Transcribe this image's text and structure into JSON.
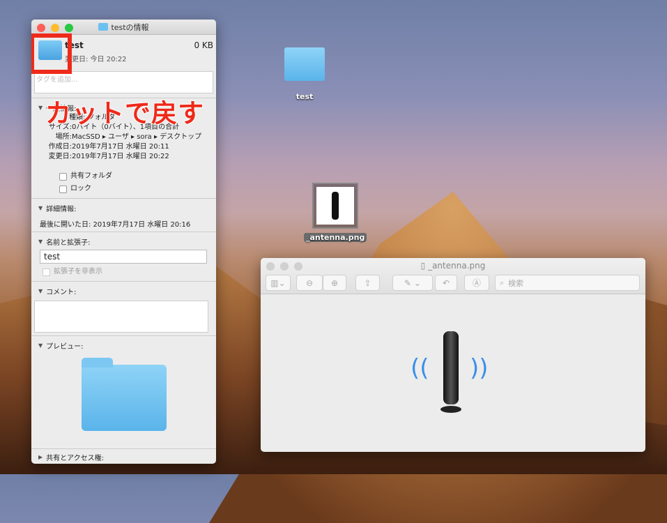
{
  "desktop": {
    "folder_label": "test",
    "file_label": "_antenna.png"
  },
  "info": {
    "title": "testの情報",
    "name": "test",
    "size": "0 KB",
    "modified_short": "変更日: 今日 20:22",
    "tags_placeholder": "タグを追加...",
    "general_header": "一般情報:",
    "kind": "種類: フォルダ",
    "rows": [
      {
        "k": "サイズ:",
        "v": "0バイト（0バイト）、1項目の合計"
      },
      {
        "k": "場所:",
        "v": "MacSSD ▸ ユーザ ▸ sora ▸ デスクトップ"
      },
      {
        "k": "作成日:",
        "v": "2019年7月17日 水曜日 20:11"
      },
      {
        "k": "変更日:",
        "v": "2019年7月17日 水曜日 20:22"
      }
    ],
    "shared_folder": "共有フォルダ",
    "lock": "ロック",
    "more_header": "詳細情報:",
    "last_opened": "最後に開いた日: 2019年7月17日 水曜日 20:16",
    "name_ext_header": "名前と拡張子:",
    "name_value": "test",
    "hide_ext": "拡張子を非表示",
    "comment_header": "コメント:",
    "preview_header": "プレビュー:",
    "sharing_header": "共有とアクセス権:"
  },
  "overlay_text": "カットで戻す",
  "preview": {
    "title": "_antenna.png",
    "search_placeholder": "検索"
  }
}
